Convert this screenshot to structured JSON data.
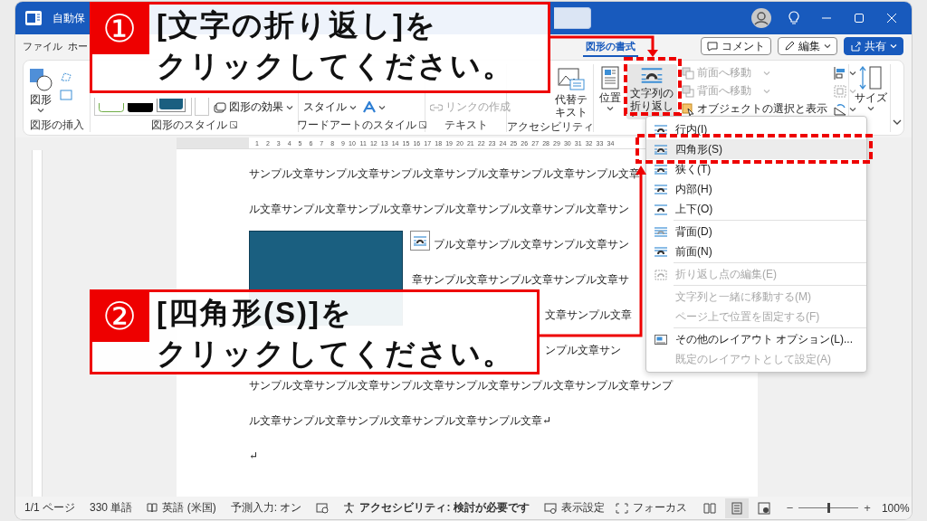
{
  "title_bar": {
    "title": "自動保"
  },
  "tabs": [
    {
      "label": "ファイル",
      "selected": false
    },
    {
      "label": "ホー",
      "selected": false
    },
    {
      "label": "図形の書式",
      "selected": true
    }
  ],
  "header_buttons": [
    {
      "label": "コメント",
      "kind": "comment"
    },
    {
      "label": "編集",
      "kind": "edit"
    },
    {
      "label": "共有",
      "kind": "share"
    }
  ],
  "ribbon": {
    "groups": [
      {
        "label": "図形の挿入",
        "items": [
          {
            "label": "図形",
            "disabled": false
          }
        ]
      },
      {
        "label": "図形のスタイル",
        "items": [
          {
            "label": "図形の効果",
            "disabled": false
          }
        ]
      },
      {
        "label": "ワードアートのスタイル",
        "items": [
          {
            "label": "スタイル",
            "disabled": false
          }
        ]
      },
      {
        "label": "テキスト",
        "items": [
          {
            "label": "リンクの作成",
            "disabled": true
          }
        ]
      },
      {
        "label": "アクセシビリティ",
        "items": [
          {
            "label": "代替テキスト",
            "disabled": false
          }
        ]
      },
      {
        "items": [
          {
            "label": "位置",
            "disabled": false
          },
          {
            "label": "文字列の折り返し",
            "disabled": false
          },
          {
            "label": "前面へ移動",
            "disabled": true
          },
          {
            "label": "背面へ移動",
            "disabled": true
          },
          {
            "label": "オブジェクトの選択と表示",
            "disabled": false
          }
        ]
      },
      {
        "items": [
          {
            "label": "サイズ",
            "disabled": false
          }
        ]
      }
    ]
  },
  "ruler": {
    "labels": [
      "1",
      "2",
      "3",
      "4",
      "5",
      "6",
      "7",
      "8",
      "9",
      "10",
      "11",
      "12",
      "13",
      "14",
      "15",
      "16",
      "17",
      "18",
      "19",
      "20",
      "21",
      "22",
      "23",
      "24",
      "25",
      "26",
      "27",
      "28",
      "29",
      "30",
      "31",
      "32",
      "33",
      "34"
    ]
  },
  "document": {
    "lines": [
      {
        "text": "サンプル文章サンプル文章サンプル文章サンプル文章サンプル文章サンプル文章",
        "kind": "full"
      },
      {
        "text": "ル文章サンプル文章サンプル文章サンプル文章サンプル文章サンプル文章サン",
        "kind": "full"
      },
      {
        "text": "プル文章サンプル文章サンプル文章サン",
        "kind": "beside-icon"
      },
      {
        "text": "章サンプル文章サンプル文章サンプル文章サ",
        "kind": "beside-shape"
      },
      {
        "text": "文章サンプル文章",
        "kind": "after-callout"
      },
      {
        "text": "ンプル文章サン",
        "kind": "after-callout"
      },
      {
        "text": "サンプル文章サンプル文章サンプル文章サンプル文章サンプル文章サンプル文章サンプ",
        "kind": "full"
      },
      {
        "text": "ル文章サンプル文章サンプル文章サンプル文章サンプル文章↵",
        "kind": "full"
      },
      {
        "text": "↵",
        "kind": "full"
      }
    ]
  },
  "wrap_menu": {
    "sections": [
      {
        "items": [
          {
            "label": "行内(I)",
            "kind": "inline",
            "selected": false,
            "disabled": false
          },
          {
            "label": "四角形(S)",
            "kind": "square",
            "selected": true,
            "disabled": false
          },
          {
            "label": "狭く(T)",
            "kind": "tight",
            "selected": false,
            "disabled": false
          },
          {
            "label": "内部(H)",
            "kind": "through",
            "selected": false,
            "disabled": false
          },
          {
            "label": "上下(O)",
            "kind": "topbottom",
            "selected": false,
            "disabled": false
          }
        ]
      },
      {
        "items": [
          {
            "label": "背面(D)",
            "kind": "behind",
            "selected": false,
            "disabled": false
          },
          {
            "label": "前面(N)",
            "kind": "front",
            "selected": false,
            "disabled": false
          }
        ]
      },
      {
        "items": [
          {
            "label": "折り返し点の編集(E)",
            "kind": "points",
            "selected": false,
            "disabled": true
          }
        ]
      },
      {
        "items": [
          {
            "label": "文字列と一緒に移動する(M)",
            "kind": "plain",
            "selected": false,
            "disabled": true
          },
          {
            "label": "ページ上で位置を固定する(F)",
            "kind": "plain",
            "selected": false,
            "disabled": true
          }
        ]
      },
      {
        "items": [
          {
            "label": "その他のレイアウト オプション(L)...",
            "kind": "layout",
            "selected": false,
            "disabled": false
          },
          {
            "label": "既定のレイアウトとして設定(A)",
            "kind": "plain",
            "selected": false,
            "disabled": true
          }
        ]
      }
    ]
  },
  "status_bar": {
    "left": [
      {
        "label": "1/1 ページ",
        "kind": "plain"
      },
      {
        "label": "330 単語",
        "kind": "plain"
      },
      {
        "label": "英語 (米国)",
        "kind": "proofing"
      },
      {
        "label": "予測入力: オン",
        "kind": "plain"
      },
      {
        "label": "アクセシビリティ: 検討が必要です",
        "kind": "accessibility"
      }
    ],
    "right": [
      {
        "label": "表示設定",
        "kind": "display"
      },
      {
        "label": "フォーカス",
        "kind": "focus"
      }
    ],
    "views": [
      {
        "selected": false
      },
      {
        "selected": true
      },
      {
        "selected": false
      }
    ],
    "zoom": {
      "minus": "−",
      "plus": "+",
      "level": 0.5,
      "reading": "100%"
    }
  },
  "callouts": [
    {
      "number": "①",
      "lines": [
        "[文字の折り返し]を",
        "クリックしてください。"
      ]
    },
    {
      "number": "②",
      "lines": [
        "[四角形(S)]を",
        "クリックしてください。"
      ]
    }
  ]
}
